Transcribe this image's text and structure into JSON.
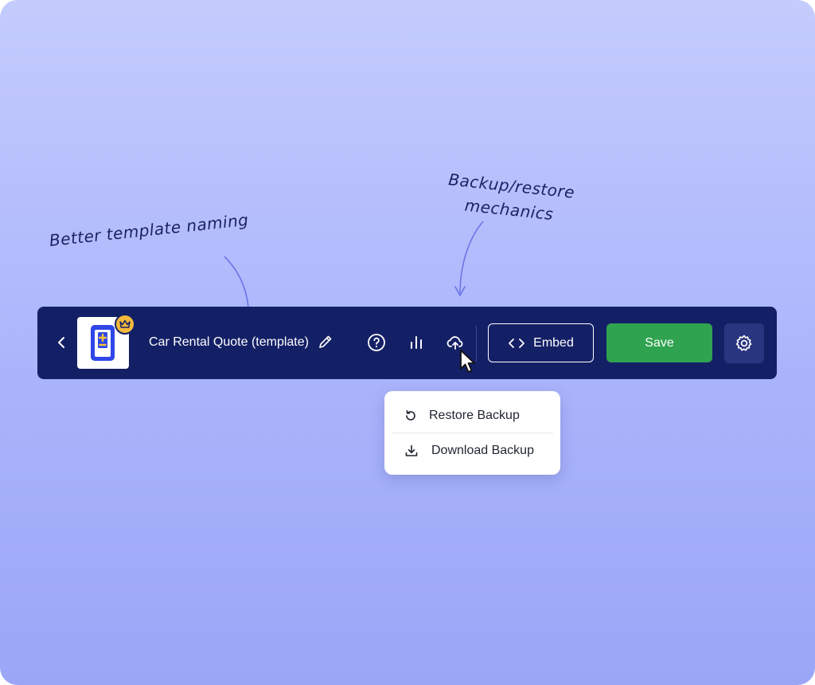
{
  "annotations": {
    "naming": "Better template naming",
    "backup_line1": "Backup/restore",
    "backup_line2": "mechanics"
  },
  "toolbar": {
    "title": "Car Rental Quote (template)",
    "embed_label": "Embed",
    "save_label": "Save",
    "icons": [
      "chevron-left-icon",
      "crown-icon",
      "pencil-icon",
      "help-circle-icon",
      "bar-chart-icon",
      "cloud-upload-icon",
      "code-icon",
      "gear-icon"
    ]
  },
  "backup_menu": {
    "items": [
      {
        "label": "Restore Backup",
        "icon": "restore-icon"
      },
      {
        "label": "Download Backup",
        "icon": "download-icon"
      }
    ]
  },
  "colors": {
    "toolbar_bg": "#142066",
    "save_green": "#2fa34f",
    "crown_badge": "#f5b93b",
    "app_icon_blue": "#2f46e8",
    "annotation_text": "#1b2266",
    "annotation_arrow": "#6c76e6"
  }
}
